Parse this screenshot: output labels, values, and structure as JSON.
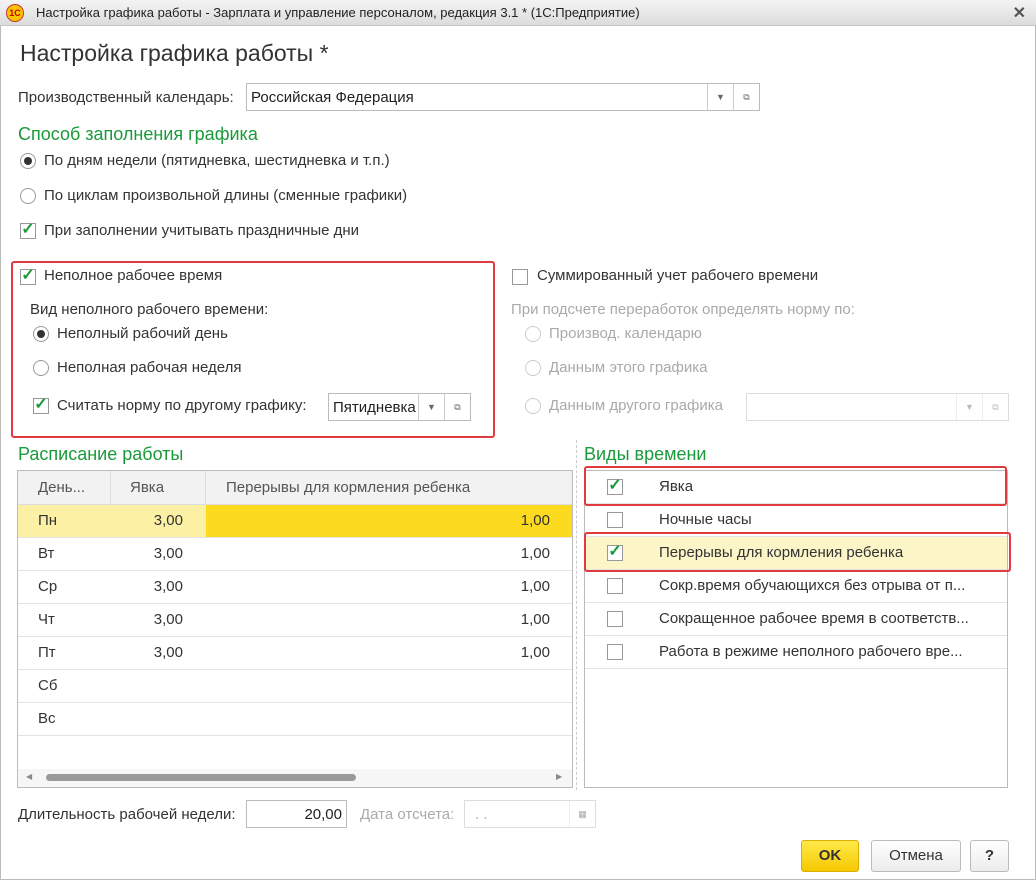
{
  "window": {
    "title": "Настройка графика работы - Зарплата и управление персоналом, редакция 3.1 * (1С:Предприятие)",
    "logo": "1С",
    "close": "✕"
  },
  "form": {
    "heading": "Настройка графика работы *",
    "calendar": {
      "label": "Производственный календарь:",
      "value": "Российская Федерация"
    },
    "fill_method": {
      "title": "Способ заполнения графика",
      "options": [
        "По дням недели (пятидневка, шестидневка и т.п.)",
        "По циклам произвольной длины (сменные графики)"
      ],
      "selected": 0,
      "holidays_label": "При заполнении учитывать праздничные дни",
      "holidays_checked": true
    },
    "part_time": {
      "label": "Неполное рабочее время",
      "checked": true,
      "kind_label": "Вид неполного рабочего времени:",
      "options": [
        "Неполный рабочий день",
        "Неполная рабочая неделя"
      ],
      "selected": 0,
      "norm_label": "Считать норму по другому графику:",
      "norm_checked": true,
      "norm_value": "Пятидневка"
    },
    "summed": {
      "label": "Суммированный учет рабочего времени",
      "checked": false,
      "norm_label": "При подсчете переработок определять норму по:",
      "options": [
        "Производ. календарю",
        "Данным этого графика",
        "Данным другого графика"
      ]
    },
    "schedule": {
      "title": "Расписание работы",
      "columns": [
        "День...",
        "Явка",
        "Перерывы для кормления ребенка"
      ],
      "rows": [
        [
          "Пн",
          "3,00",
          "1,00"
        ],
        [
          "Вт",
          "3,00",
          "1,00"
        ],
        [
          "Ср",
          "3,00",
          "1,00"
        ],
        [
          "Чт",
          "3,00",
          "1,00"
        ],
        [
          "Пт",
          "3,00",
          "1,00"
        ],
        [
          "Сб",
          "",
          ""
        ],
        [
          "Вс",
          "",
          ""
        ]
      ]
    },
    "time_types": {
      "title": "Виды времени",
      "items": [
        {
          "label": "Явка",
          "checked": true
        },
        {
          "label": "Ночные часы",
          "checked": false
        },
        {
          "label": "Перерывы для кормления ребенка",
          "checked": true
        },
        {
          "label": "Сокр.время обучающихся без отрыва от п...",
          "checked": false
        },
        {
          "label": "Сокращенное рабочее время в соответств...",
          "checked": false
        },
        {
          "label": "Работа в режиме неполного рабочего вре...",
          "checked": false
        }
      ]
    },
    "week_length": {
      "label": "Длительность рабочей недели:",
      "value": "20,00"
    },
    "ref_date": {
      "label": "Дата отсчета:",
      "value": " .  ."
    },
    "buttons": {
      "ok": "OK",
      "cancel": "Отмена",
      "help": "?"
    }
  },
  "colors": {
    "accent": "#1a9a3a",
    "highlight": "#fbda1f",
    "row_sel": "#fcf0a4",
    "red": "#e0393e"
  }
}
